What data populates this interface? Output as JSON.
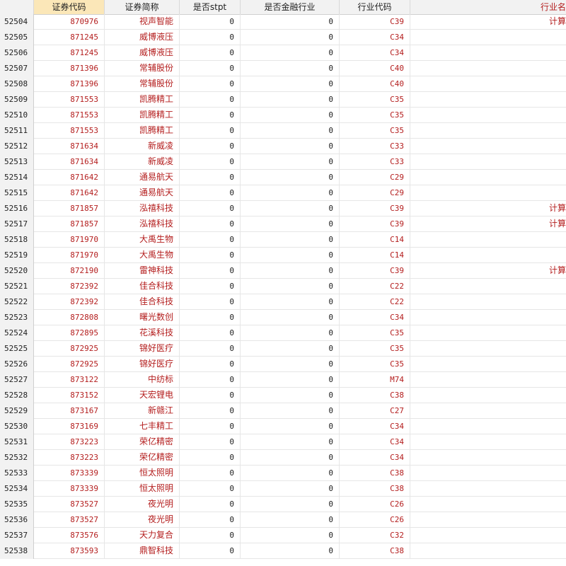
{
  "columns": [
    "",
    "证券代码",
    "证券简称",
    "是否stpt",
    "是否金融行业",
    "行业代码",
    "行业名"
  ],
  "rows": [
    {
      "n": "52504",
      "code": "870976",
      "name": "视声智能",
      "stpt": "0",
      "fin": "0",
      "ind": "C39",
      "indname": "计算"
    },
    {
      "n": "52505",
      "code": "871245",
      "name": "威博液压",
      "stpt": "0",
      "fin": "0",
      "ind": "C34",
      "indname": ""
    },
    {
      "n": "52506",
      "code": "871245",
      "name": "威博液压",
      "stpt": "0",
      "fin": "0",
      "ind": "C34",
      "indname": ""
    },
    {
      "n": "52507",
      "code": "871396",
      "name": "常辅股份",
      "stpt": "0",
      "fin": "0",
      "ind": "C40",
      "indname": ""
    },
    {
      "n": "52508",
      "code": "871396",
      "name": "常辅股份",
      "stpt": "0",
      "fin": "0",
      "ind": "C40",
      "indname": ""
    },
    {
      "n": "52509",
      "code": "871553",
      "name": "凯腾精工",
      "stpt": "0",
      "fin": "0",
      "ind": "C35",
      "indname": ""
    },
    {
      "n": "52510",
      "code": "871553",
      "name": "凯腾精工",
      "stpt": "0",
      "fin": "0",
      "ind": "C35",
      "indname": ""
    },
    {
      "n": "52511",
      "code": "871553",
      "name": "凯腾精工",
      "stpt": "0",
      "fin": "0",
      "ind": "C35",
      "indname": ""
    },
    {
      "n": "52512",
      "code": "871634",
      "name": "新威凌",
      "stpt": "0",
      "fin": "0",
      "ind": "C33",
      "indname": ""
    },
    {
      "n": "52513",
      "code": "871634",
      "name": "新威凌",
      "stpt": "0",
      "fin": "0",
      "ind": "C33",
      "indname": ""
    },
    {
      "n": "52514",
      "code": "871642",
      "name": "通易航天",
      "stpt": "0",
      "fin": "0",
      "ind": "C29",
      "indname": ""
    },
    {
      "n": "52515",
      "code": "871642",
      "name": "通易航天",
      "stpt": "0",
      "fin": "0",
      "ind": "C29",
      "indname": ""
    },
    {
      "n": "52516",
      "code": "871857",
      "name": "泓禧科技",
      "stpt": "0",
      "fin": "0",
      "ind": "C39",
      "indname": "计算"
    },
    {
      "n": "52517",
      "code": "871857",
      "name": "泓禧科技",
      "stpt": "0",
      "fin": "0",
      "ind": "C39",
      "indname": "计算"
    },
    {
      "n": "52518",
      "code": "871970",
      "name": "大禹生物",
      "stpt": "0",
      "fin": "0",
      "ind": "C14",
      "indname": ""
    },
    {
      "n": "52519",
      "code": "871970",
      "name": "大禹生物",
      "stpt": "0",
      "fin": "0",
      "ind": "C14",
      "indname": ""
    },
    {
      "n": "52520",
      "code": "872190",
      "name": "雷神科技",
      "stpt": "0",
      "fin": "0",
      "ind": "C39",
      "indname": "计算"
    },
    {
      "n": "52521",
      "code": "872392",
      "name": "佳合科技",
      "stpt": "0",
      "fin": "0",
      "ind": "C22",
      "indname": ""
    },
    {
      "n": "52522",
      "code": "872392",
      "name": "佳合科技",
      "stpt": "0",
      "fin": "0",
      "ind": "C22",
      "indname": ""
    },
    {
      "n": "52523",
      "code": "872808",
      "name": "曙光数创",
      "stpt": "0",
      "fin": "0",
      "ind": "C34",
      "indname": ""
    },
    {
      "n": "52524",
      "code": "872895",
      "name": "花溪科技",
      "stpt": "0",
      "fin": "0",
      "ind": "C35",
      "indname": ""
    },
    {
      "n": "52525",
      "code": "872925",
      "name": "锦好医疗",
      "stpt": "0",
      "fin": "0",
      "ind": "C35",
      "indname": ""
    },
    {
      "n": "52526",
      "code": "872925",
      "name": "锦好医疗",
      "stpt": "0",
      "fin": "0",
      "ind": "C35",
      "indname": ""
    },
    {
      "n": "52527",
      "code": "873122",
      "name": "中纺标",
      "stpt": "0",
      "fin": "0",
      "ind": "M74",
      "indname": ""
    },
    {
      "n": "52528",
      "code": "873152",
      "name": "天宏锂电",
      "stpt": "0",
      "fin": "0",
      "ind": "C38",
      "indname": ""
    },
    {
      "n": "52529",
      "code": "873167",
      "name": "新赣江",
      "stpt": "0",
      "fin": "0",
      "ind": "C27",
      "indname": ""
    },
    {
      "n": "52530",
      "code": "873169",
      "name": "七丰精工",
      "stpt": "0",
      "fin": "0",
      "ind": "C34",
      "indname": ""
    },
    {
      "n": "52531",
      "code": "873223",
      "name": "荣亿精密",
      "stpt": "0",
      "fin": "0",
      "ind": "C34",
      "indname": ""
    },
    {
      "n": "52532",
      "code": "873223",
      "name": "荣亿精密",
      "stpt": "0",
      "fin": "0",
      "ind": "C34",
      "indname": ""
    },
    {
      "n": "52533",
      "code": "873339",
      "name": "恒太照明",
      "stpt": "0",
      "fin": "0",
      "ind": "C38",
      "indname": ""
    },
    {
      "n": "52534",
      "code": "873339",
      "name": "恒太照明",
      "stpt": "0",
      "fin": "0",
      "ind": "C38",
      "indname": ""
    },
    {
      "n": "52535",
      "code": "873527",
      "name": "夜光明",
      "stpt": "0",
      "fin": "0",
      "ind": "C26",
      "indname": ""
    },
    {
      "n": "52536",
      "code": "873527",
      "name": "夜光明",
      "stpt": "0",
      "fin": "0",
      "ind": "C26",
      "indname": ""
    },
    {
      "n": "52537",
      "code": "873576",
      "name": "天力复合",
      "stpt": "0",
      "fin": "0",
      "ind": "C32",
      "indname": ""
    },
    {
      "n": "52538",
      "code": "873593",
      "name": "鼎智科技",
      "stpt": "0",
      "fin": "0",
      "ind": "C38",
      "indname": ""
    }
  ]
}
